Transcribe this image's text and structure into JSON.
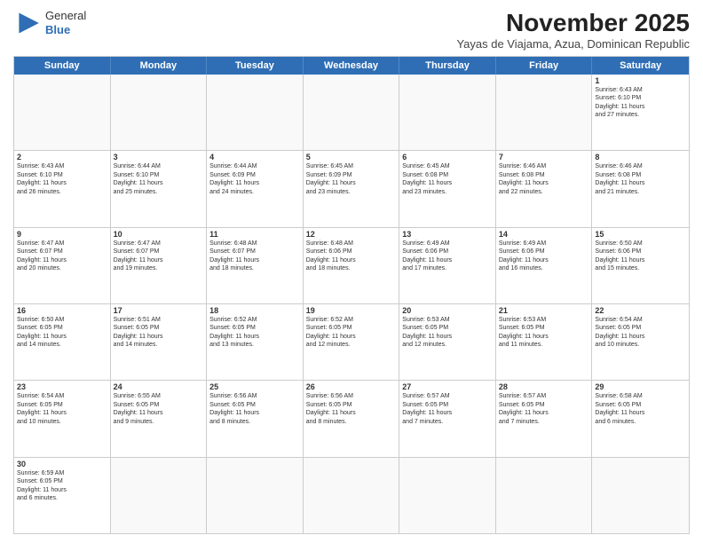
{
  "header": {
    "logo_general": "General",
    "logo_blue": "Blue",
    "month_title": "November 2025",
    "subtitle": "Yayas de Viajama, Azua, Dominican Republic"
  },
  "days_of_week": [
    "Sunday",
    "Monday",
    "Tuesday",
    "Wednesday",
    "Thursday",
    "Friday",
    "Saturday"
  ],
  "weeks": [
    [
      {
        "day": "",
        "info": ""
      },
      {
        "day": "",
        "info": ""
      },
      {
        "day": "",
        "info": ""
      },
      {
        "day": "",
        "info": ""
      },
      {
        "day": "",
        "info": ""
      },
      {
        "day": "",
        "info": ""
      },
      {
        "day": "1",
        "info": "Sunrise: 6:43 AM\nSunset: 6:10 PM\nDaylight: 11 hours\nand 27 minutes."
      }
    ],
    [
      {
        "day": "2",
        "info": "Sunrise: 6:43 AM\nSunset: 6:10 PM\nDaylight: 11 hours\nand 26 minutes."
      },
      {
        "day": "3",
        "info": "Sunrise: 6:44 AM\nSunset: 6:10 PM\nDaylight: 11 hours\nand 25 minutes."
      },
      {
        "day": "4",
        "info": "Sunrise: 6:44 AM\nSunset: 6:09 PM\nDaylight: 11 hours\nand 24 minutes."
      },
      {
        "day": "5",
        "info": "Sunrise: 6:45 AM\nSunset: 6:09 PM\nDaylight: 11 hours\nand 23 minutes."
      },
      {
        "day": "6",
        "info": "Sunrise: 6:45 AM\nSunset: 6:08 PM\nDaylight: 11 hours\nand 23 minutes."
      },
      {
        "day": "7",
        "info": "Sunrise: 6:46 AM\nSunset: 6:08 PM\nDaylight: 11 hours\nand 22 minutes."
      },
      {
        "day": "8",
        "info": "Sunrise: 6:46 AM\nSunset: 6:08 PM\nDaylight: 11 hours\nand 21 minutes."
      }
    ],
    [
      {
        "day": "9",
        "info": "Sunrise: 6:47 AM\nSunset: 6:07 PM\nDaylight: 11 hours\nand 20 minutes."
      },
      {
        "day": "10",
        "info": "Sunrise: 6:47 AM\nSunset: 6:07 PM\nDaylight: 11 hours\nand 19 minutes."
      },
      {
        "day": "11",
        "info": "Sunrise: 6:48 AM\nSunset: 6:07 PM\nDaylight: 11 hours\nand 18 minutes."
      },
      {
        "day": "12",
        "info": "Sunrise: 6:48 AM\nSunset: 6:06 PM\nDaylight: 11 hours\nand 18 minutes."
      },
      {
        "day": "13",
        "info": "Sunrise: 6:49 AM\nSunset: 6:06 PM\nDaylight: 11 hours\nand 17 minutes."
      },
      {
        "day": "14",
        "info": "Sunrise: 6:49 AM\nSunset: 6:06 PM\nDaylight: 11 hours\nand 16 minutes."
      },
      {
        "day": "15",
        "info": "Sunrise: 6:50 AM\nSunset: 6:06 PM\nDaylight: 11 hours\nand 15 minutes."
      }
    ],
    [
      {
        "day": "16",
        "info": "Sunrise: 6:50 AM\nSunset: 6:05 PM\nDaylight: 11 hours\nand 14 minutes."
      },
      {
        "day": "17",
        "info": "Sunrise: 6:51 AM\nSunset: 6:05 PM\nDaylight: 11 hours\nand 14 minutes."
      },
      {
        "day": "18",
        "info": "Sunrise: 6:52 AM\nSunset: 6:05 PM\nDaylight: 11 hours\nand 13 minutes."
      },
      {
        "day": "19",
        "info": "Sunrise: 6:52 AM\nSunset: 6:05 PM\nDaylight: 11 hours\nand 12 minutes."
      },
      {
        "day": "20",
        "info": "Sunrise: 6:53 AM\nSunset: 6:05 PM\nDaylight: 11 hours\nand 12 minutes."
      },
      {
        "day": "21",
        "info": "Sunrise: 6:53 AM\nSunset: 6:05 PM\nDaylight: 11 hours\nand 11 minutes."
      },
      {
        "day": "22",
        "info": "Sunrise: 6:54 AM\nSunset: 6:05 PM\nDaylight: 11 hours\nand 10 minutes."
      }
    ],
    [
      {
        "day": "23",
        "info": "Sunrise: 6:54 AM\nSunset: 6:05 PM\nDaylight: 11 hours\nand 10 minutes."
      },
      {
        "day": "24",
        "info": "Sunrise: 6:55 AM\nSunset: 6:05 PM\nDaylight: 11 hours\nand 9 minutes."
      },
      {
        "day": "25",
        "info": "Sunrise: 6:56 AM\nSunset: 6:05 PM\nDaylight: 11 hours\nand 8 minutes."
      },
      {
        "day": "26",
        "info": "Sunrise: 6:56 AM\nSunset: 6:05 PM\nDaylight: 11 hours\nand 8 minutes."
      },
      {
        "day": "27",
        "info": "Sunrise: 6:57 AM\nSunset: 6:05 PM\nDaylight: 11 hours\nand 7 minutes."
      },
      {
        "day": "28",
        "info": "Sunrise: 6:57 AM\nSunset: 6:05 PM\nDaylight: 11 hours\nand 7 minutes."
      },
      {
        "day": "29",
        "info": "Sunrise: 6:58 AM\nSunset: 6:05 PM\nDaylight: 11 hours\nand 6 minutes."
      }
    ],
    [
      {
        "day": "30",
        "info": "Sunrise: 6:59 AM\nSunset: 6:05 PM\nDaylight: 11 hours\nand 6 minutes."
      },
      {
        "day": "",
        "info": ""
      },
      {
        "day": "",
        "info": ""
      },
      {
        "day": "",
        "info": ""
      },
      {
        "day": "",
        "info": ""
      },
      {
        "day": "",
        "info": ""
      },
      {
        "day": "",
        "info": ""
      }
    ]
  ]
}
